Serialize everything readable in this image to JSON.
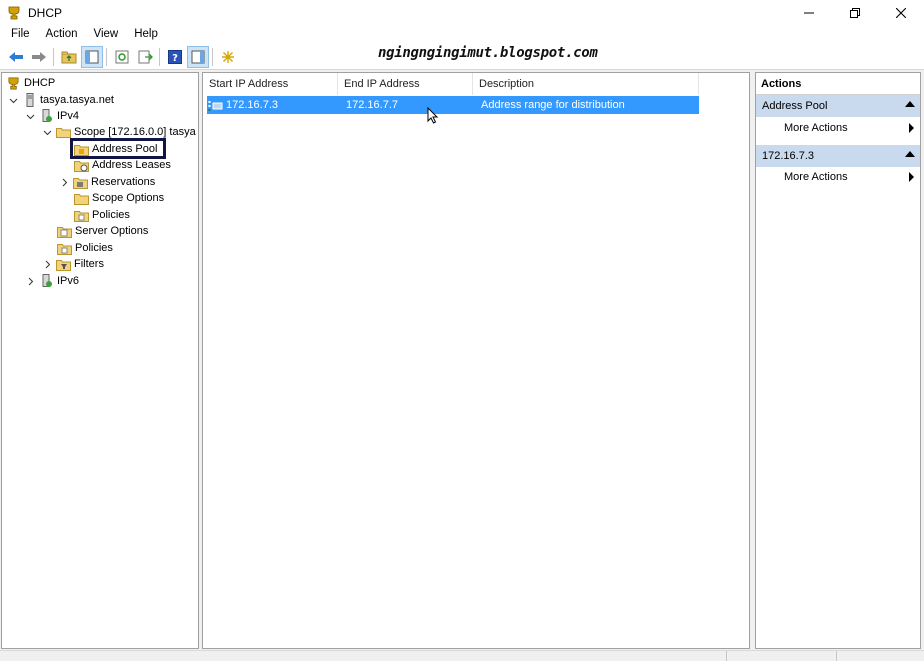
{
  "window": {
    "title": "DHCP"
  },
  "menu": [
    "File",
    "Action",
    "View",
    "Help"
  ],
  "watermark": "ngingngingimut.blogspot.com",
  "tree": {
    "root": "DHCP",
    "server": "tasya.tasya.net",
    "ipv4": "IPv4",
    "scope": "Scope [172.16.0.0] tasya",
    "address_pool": "Address Pool",
    "address_leases": "Address Leases",
    "reservations": "Reservations",
    "scope_options": "Scope Options",
    "scope_policies": "Policies",
    "server_options": "Server Options",
    "policies": "Policies",
    "filters": "Filters",
    "ipv6": "IPv6"
  },
  "list": {
    "columns": [
      "Start IP Address",
      "End IP Address",
      "Description"
    ],
    "rows": [
      {
        "start": "172.16.7.3",
        "end": "172.16.7.7",
        "description": "Address range for distribution"
      }
    ]
  },
  "actions": {
    "title": "Actions",
    "sections": [
      {
        "label": "Address Pool",
        "item": "More Actions"
      },
      {
        "label": "172.16.7.3",
        "item": "More Actions"
      }
    ]
  },
  "colors": {
    "selection": "#3399ff",
    "action_header": "#c9d9ee",
    "highlight_box": "#101545"
  }
}
